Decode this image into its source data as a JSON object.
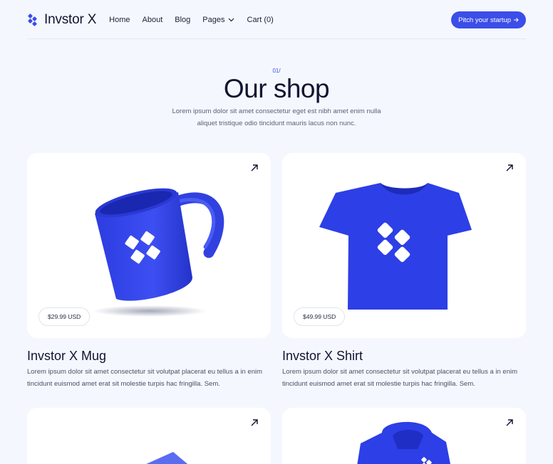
{
  "brand": {
    "name": "Invstor X",
    "accent": "#3b4ee8"
  },
  "nav": {
    "links": [
      "Home",
      "About",
      "Blog",
      "Pages",
      "Cart (0)"
    ],
    "cta": "Pitch your startup"
  },
  "section": {
    "eyebrow": "01/",
    "title": "Our shop",
    "subtitle": "Lorem ipsum dolor sit amet consectetur eget est nibh amet enim nulla aliquet tristique odio tincidunt mauris lacus non nunc."
  },
  "products": [
    {
      "name": "Invstor X Mug",
      "price": "$29.99 USD",
      "desc": "Lorem ipsum dolor sit amet consectetur sit volutpat placerat eu tellus a in enim tincidunt euismod amet erat sit molestie turpis hac fringilla. Sem."
    },
    {
      "name": "Invstor X Shirt",
      "price": "$49.99 USD",
      "desc": "Lorem ipsum dolor sit amet consectetur sit volutpat placerat eu tellus a in enim tincidunt euismod amet erat sit molestie turpis hac fringilla. Sem."
    }
  ]
}
